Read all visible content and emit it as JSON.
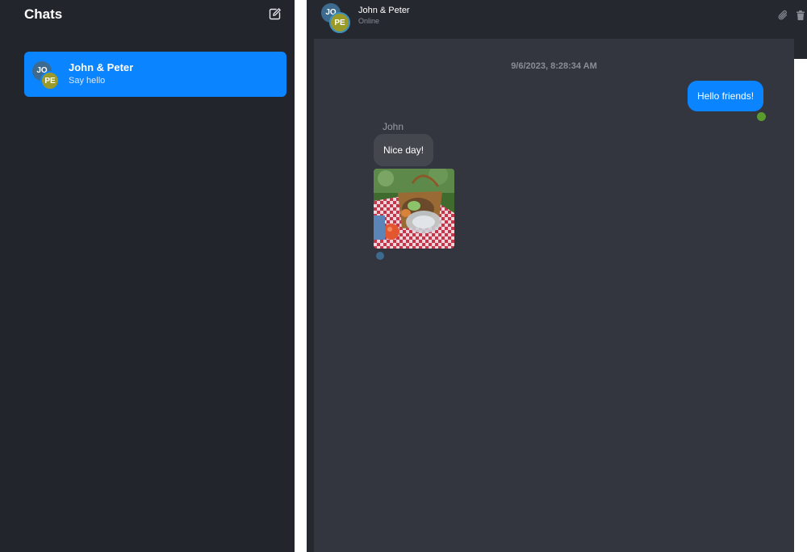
{
  "sidebar": {
    "title": "Chats",
    "compose_icon": "compose-icon",
    "chats": [
      {
        "name": "John & Peter",
        "preview": "Say hello",
        "avatars": [
          "JO",
          "PE"
        ],
        "selected": true
      }
    ]
  },
  "header": {
    "name": "John & Peter",
    "status": "Online",
    "avatars": [
      "JO",
      "PE"
    ],
    "actions": [
      "paperclip-icon",
      "trash-icon"
    ]
  },
  "conversation": {
    "timestamp": "9/6/2023, 8:28:34 AM",
    "messages": [
      {
        "direction": "outgoing",
        "text": "Hello friends!"
      },
      {
        "direction": "incoming",
        "sender": "John",
        "text": "Nice day!"
      },
      {
        "direction": "incoming",
        "type": "image",
        "content": "picnic-photo"
      }
    ]
  },
  "colors": {
    "sidebar_bg": "#23252d",
    "chat_bg": "#33353f",
    "accent": "#0a84ff",
    "incoming_bubble": "#45474f",
    "avatar_jo": "#3d6b8f",
    "avatar_pe": "#9a9a2a"
  }
}
